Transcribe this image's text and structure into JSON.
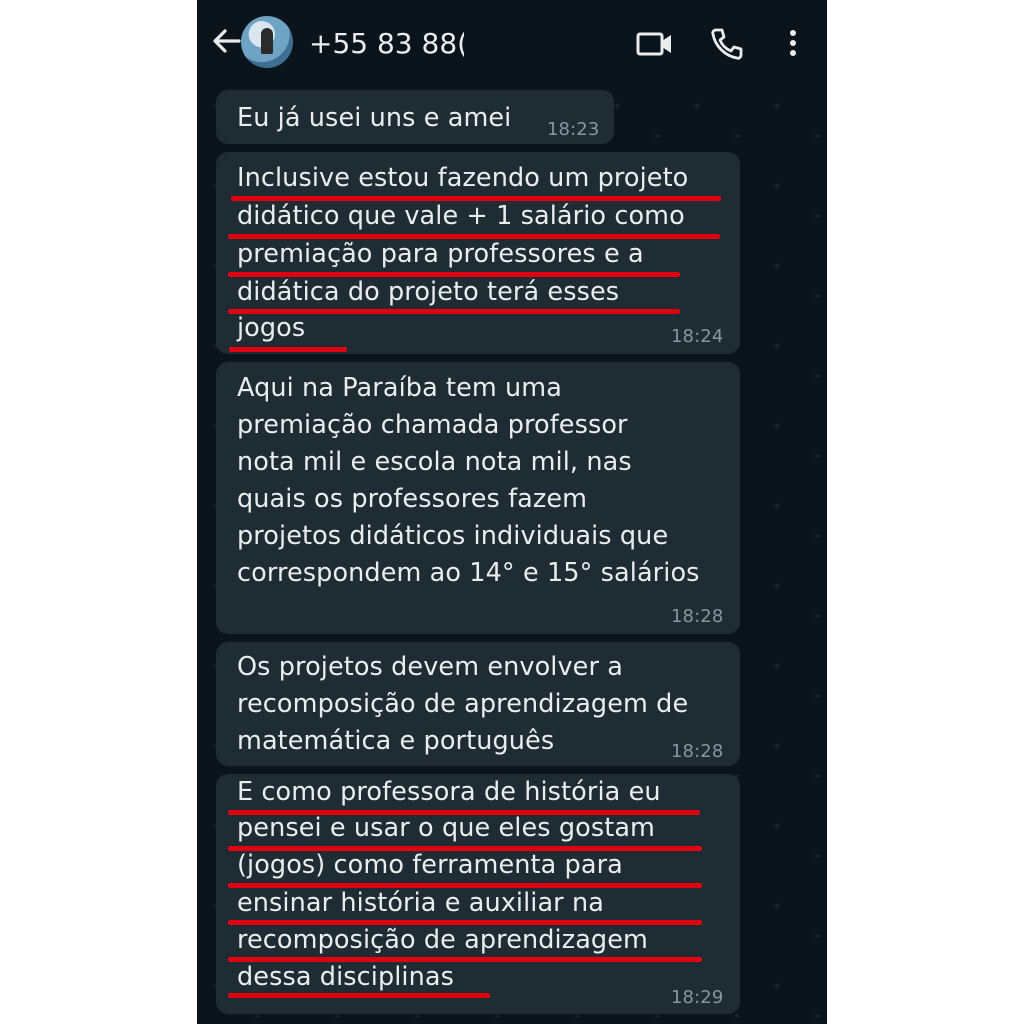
{
  "header": {
    "back_icon": "arrow-left-icon",
    "contact": "+55 83 88(",
    "video_icon": "video-call-icon",
    "call_icon": "phone-icon",
    "menu_icon": "more-vert-icon"
  },
  "messages": [
    {
      "lines": [
        "Eu já usei uns e amei"
      ],
      "time": "18:23"
    },
    {
      "lines": [
        "Inclusive estou fazendo um projeto",
        "didático que vale + 1 salário como",
        "premiação para professores e a",
        "didática do projeto terá esses",
        "jogos"
      ],
      "time": "18:24"
    },
    {
      "lines": [
        "Aqui na Paraíba tem uma",
        "premiação chamada professor",
        "nota mil e escola nota mil, nas",
        "quais os professores fazem",
        "projetos didáticos individuais que",
        "correspondem ao 14° e 15° salários"
      ],
      "time": "18:28"
    },
    {
      "lines": [
        "Os projetos devem envolver a",
        "recomposição de aprendizagem de",
        "matemática e português"
      ],
      "time": "18:28"
    },
    {
      "lines": [
        "E como professora de história eu",
        "pensei e usar o que eles gostam",
        "(jogos) como ferramenta para",
        "ensinar história e auxiliar na",
        "recomposição de aprendizagem",
        "dessa disciplinas"
      ],
      "time": "18:29"
    }
  ],
  "colors": {
    "background": "#0b141a",
    "bubble": "#202c33",
    "text": "#e9edef",
    "timestamp": "#8696a0",
    "underline": "#e0000f"
  }
}
